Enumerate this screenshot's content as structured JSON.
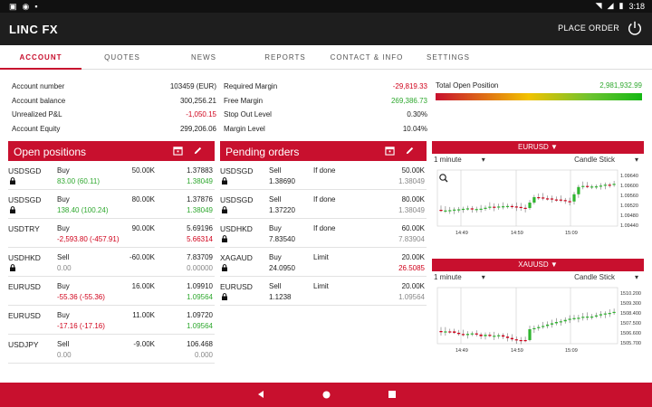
{
  "status_bar": {
    "time": "3:18"
  },
  "app": {
    "title": "LINC FX",
    "place_order": "PLACE ORDER"
  },
  "tabs": [
    "ACCOUNT",
    "QUOTES",
    "NEWS",
    "REPORTS",
    "CONTACT & INFO",
    "SETTINGS"
  ],
  "account_left": [
    {
      "label": "Account number",
      "value": "103459 (EUR)"
    },
    {
      "label": "Account balance",
      "value": "300,256.21"
    },
    {
      "label": "Unrealized P&L",
      "value": "-1,050.15"
    },
    {
      "label": "Account Equity",
      "value": "299,206.06"
    }
  ],
  "account_mid": [
    {
      "label": "Required Margin",
      "value": "-29,819.33"
    },
    {
      "label": "Free Margin",
      "value": "269,386.73"
    },
    {
      "label": "Stop Out Level",
      "value": "0.30%"
    },
    {
      "label": "Margin Level",
      "value": "10.04%"
    }
  ],
  "total_open": {
    "label": "Total Open Position",
    "value": "2,981,932.99"
  },
  "open_positions": {
    "title": "Open positions",
    "rows": [
      {
        "symbol": "USDSGD",
        "side": "Buy",
        "amount": "50.00K",
        "price": "1.37883",
        "pnl": "83.00 (60.11)",
        "cur": "1.38049",
        "locked": true,
        "pnl_color": "pos",
        "cur_color": "pos"
      },
      {
        "symbol": "USDSGD",
        "side": "Buy",
        "amount": "80.00K",
        "price": "1.37876",
        "pnl": "138.40 (100.24)",
        "cur": "1.38049",
        "locked": true,
        "pnl_color": "pos",
        "cur_color": "pos"
      },
      {
        "symbol": "USDTRY",
        "side": "Buy",
        "amount": "90.00K",
        "price": "5.69196",
        "pnl": "-2,593.80 (-457.91)",
        "cur": "5.66314",
        "locked": false,
        "pnl_color": "neg",
        "cur_color": "neg"
      },
      {
        "symbol": "USDHKD",
        "side": "Sell",
        "amount": "-60.00K",
        "price": "7.83709",
        "pnl": "0.00",
        "cur": "0.00000",
        "locked": true,
        "pnl_color": "grey",
        "cur_color": "grey"
      },
      {
        "symbol": "EURUSD",
        "side": "Buy",
        "amount": "16.00K",
        "price": "1.09910",
        "pnl": "-55.36 (-55.36)",
        "cur": "1.09564",
        "locked": false,
        "pnl_color": "neg",
        "cur_color": "pos"
      },
      {
        "symbol": "EURUSD",
        "side": "Buy",
        "amount": "11.00K",
        "price": "1.09720",
        "pnl": "-17.16 (-17.16)",
        "cur": "1.09564",
        "locked": false,
        "pnl_color": "neg",
        "cur_color": "pos"
      },
      {
        "symbol": "USDJPY",
        "side": "Sell",
        "amount": "-9.00K",
        "price": "106.468",
        "pnl": "0.00",
        "cur": "0.000",
        "locked": false,
        "pnl_color": "grey",
        "cur_color": "grey"
      }
    ]
  },
  "pending_orders": {
    "title": "Pending orders",
    "rows": [
      {
        "symbol": "USDSGD",
        "side": "Sell",
        "type": "If done",
        "amount": "50.00K",
        "price": "1.38690",
        "cur": "1.38049",
        "cur_color": "grey"
      },
      {
        "symbol": "USDSGD",
        "side": "Sell",
        "type": "If done",
        "amount": "80.00K",
        "price": "1.37220",
        "cur": "1.38049",
        "cur_color": "grey"
      },
      {
        "symbol": "USDHKD",
        "side": "Buy",
        "type": "If done",
        "amount": "60.00K",
        "price": "7.83540",
        "cur": "7.83904",
        "cur_color": "grey"
      },
      {
        "symbol": "XAGAUD",
        "side": "Buy",
        "type": "Limit",
        "amount": "20.00K",
        "price": "24.0950",
        "cur": "26.5085",
        "cur_color": "neg"
      },
      {
        "symbol": "EURUSD",
        "side": "Sell",
        "type": "Limit",
        "amount": "20.00K",
        "price": "1.1238",
        "cur": "1.09564",
        "cur_color": "grey"
      }
    ]
  },
  "charts": [
    {
      "symbol": "EURUSD ▼",
      "interval": "1 minute",
      "style": "Candle Stick",
      "yticks": [
        "1.09640",
        "1.09600",
        "1.09560",
        "1.09520",
        "1.09480",
        "1.09440"
      ],
      "xticks": [
        "14:49",
        "14:59",
        "15:09"
      ]
    },
    {
      "symbol": "XAUUSD ▼",
      "interval": "1 minute",
      "style": "Candle Stick",
      "yticks": [
        "1510.200",
        "1509.300",
        "1508.400",
        "1507.500",
        "1506.600",
        "1505.700"
      ],
      "xticks": [
        "14:49",
        "14:59",
        "15:09"
      ]
    }
  ],
  "colors": {
    "brand": "#c8102e",
    "positive": "#2fa82f",
    "negative": "#d0021b"
  }
}
